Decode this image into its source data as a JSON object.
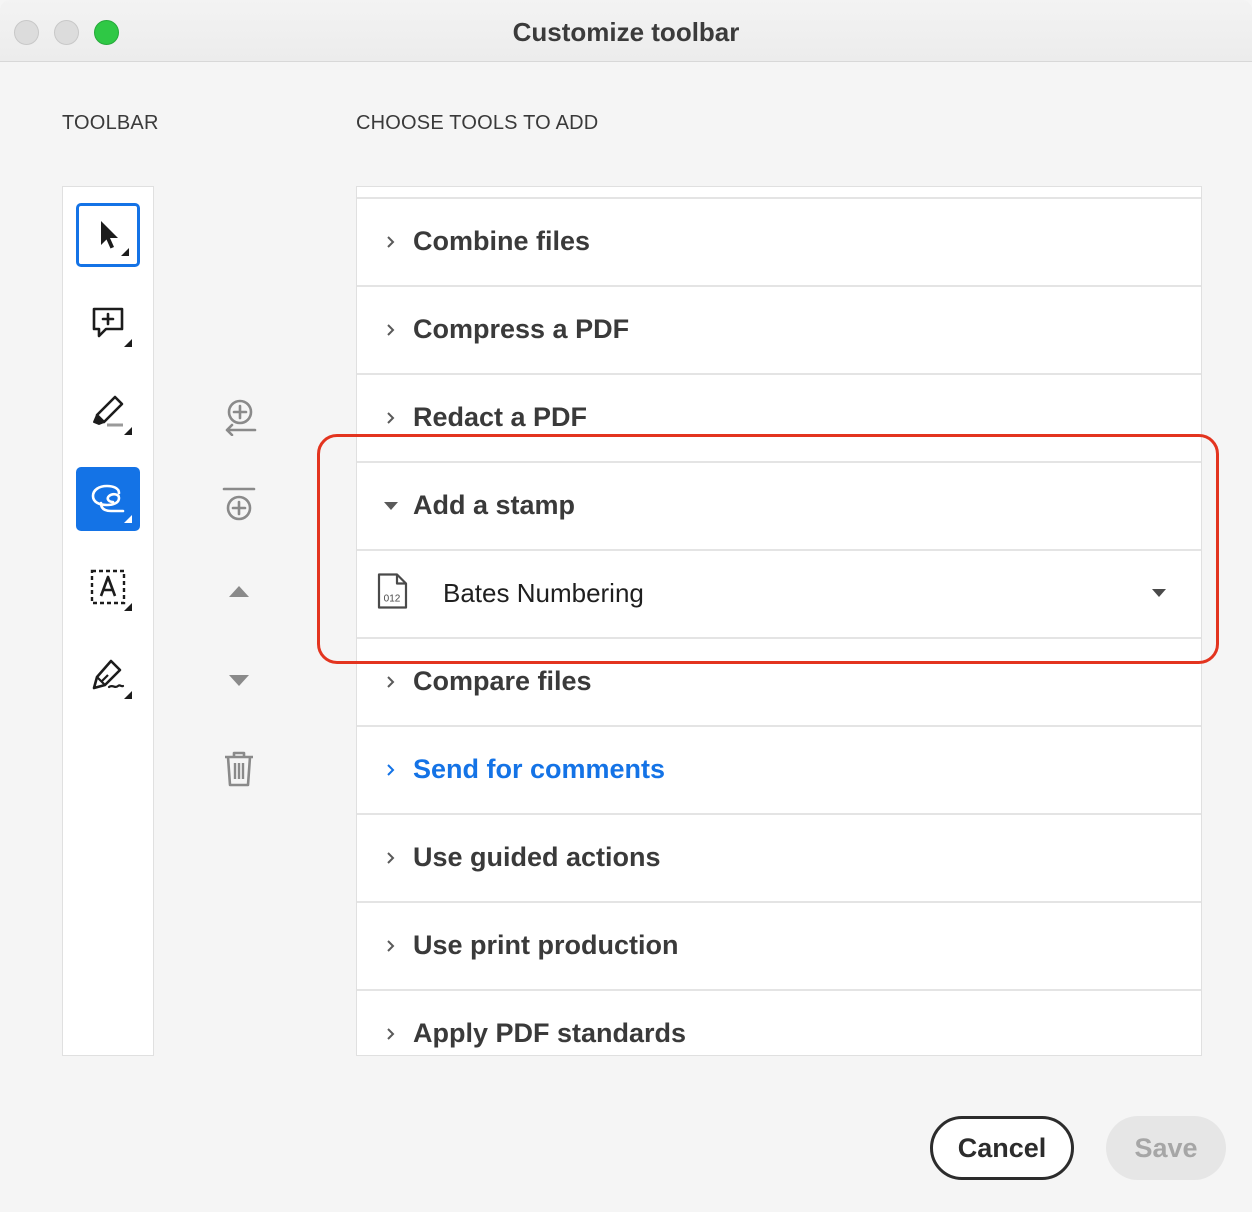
{
  "window": {
    "title": "Customize toolbar"
  },
  "toolbar_section": {
    "label": "TOOLBAR",
    "tools": [
      {
        "name": "select-tool",
        "icon": "arrow-cursor-icon",
        "state": "selected"
      },
      {
        "name": "add-comment-tool",
        "icon": "comment-add-icon",
        "state": "normal"
      },
      {
        "name": "highlight-tool",
        "icon": "highlighter-icon",
        "state": "normal"
      },
      {
        "name": "draw-freeform-tool",
        "icon": "lasso-draw-icon",
        "state": "active"
      },
      {
        "name": "add-text-tool",
        "icon": "text-box-icon",
        "state": "normal"
      },
      {
        "name": "sign-tool",
        "icon": "pen-sign-icon",
        "state": "normal"
      }
    ]
  },
  "actions": [
    {
      "name": "add-to-toolbar",
      "icon": "add-to-toolbar-icon"
    },
    {
      "name": "add-divider",
      "icon": "add-divider-icon"
    },
    {
      "name": "move-up",
      "icon": "triangle-up-icon"
    },
    {
      "name": "move-down",
      "icon": "triangle-down-icon"
    },
    {
      "name": "delete",
      "icon": "trash-icon"
    }
  ],
  "choose_section": {
    "label": "CHOOSE TOOLS TO ADD",
    "rows": [
      {
        "label": "Combine files",
        "expanded": false,
        "link": false
      },
      {
        "label": "Compress a PDF",
        "expanded": false,
        "link": false
      },
      {
        "label": "Redact a PDF",
        "expanded": false,
        "link": false
      },
      {
        "label": "Add a stamp",
        "expanded": true,
        "link": false
      },
      {
        "label": "Bates Numbering",
        "sub_item": true,
        "icon": "bates-document-icon",
        "icon_text": "012"
      },
      {
        "label": "Compare files",
        "expanded": false,
        "link": false
      },
      {
        "label": "Send for comments",
        "expanded": false,
        "link": true
      },
      {
        "label": "Use guided actions",
        "expanded": false,
        "link": false
      },
      {
        "label": "Use print production",
        "expanded": false,
        "link": false
      },
      {
        "label": "Apply PDF standards",
        "expanded": false,
        "link": false
      }
    ]
  },
  "buttons": {
    "cancel": "Cancel",
    "save": "Save"
  },
  "colors": {
    "accent": "#1473e6",
    "highlight": "#e3341f",
    "traffic_green": "#2fc845"
  }
}
